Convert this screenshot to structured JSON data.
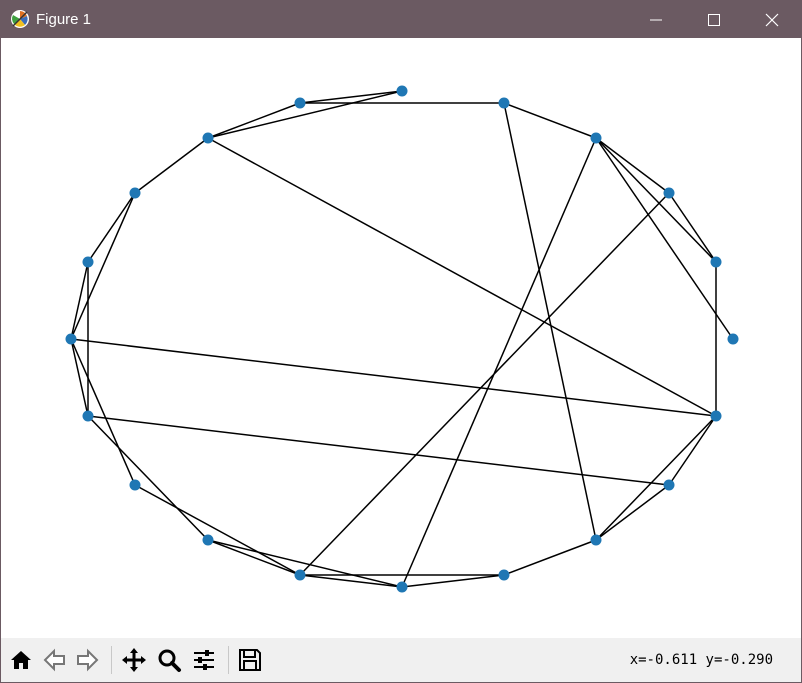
{
  "window": {
    "title": "Figure 1",
    "title_bar_color": "#6b5a62",
    "controls": [
      "minimize-icon",
      "maximize-icon",
      "close-icon"
    ]
  },
  "graph": {
    "node_color": "#1f77b4",
    "edge_color": "#000000",
    "node_count": 20,
    "edge_count": 30
  },
  "toolbar": {
    "tools": [
      "home-icon",
      "back-arrow-icon",
      "forward-arrow-icon",
      "pan-icon",
      "zoom-icon",
      "configure-subplots-icon",
      "save-icon"
    ],
    "coordinates": "x=-0.611 y=-0.290"
  }
}
